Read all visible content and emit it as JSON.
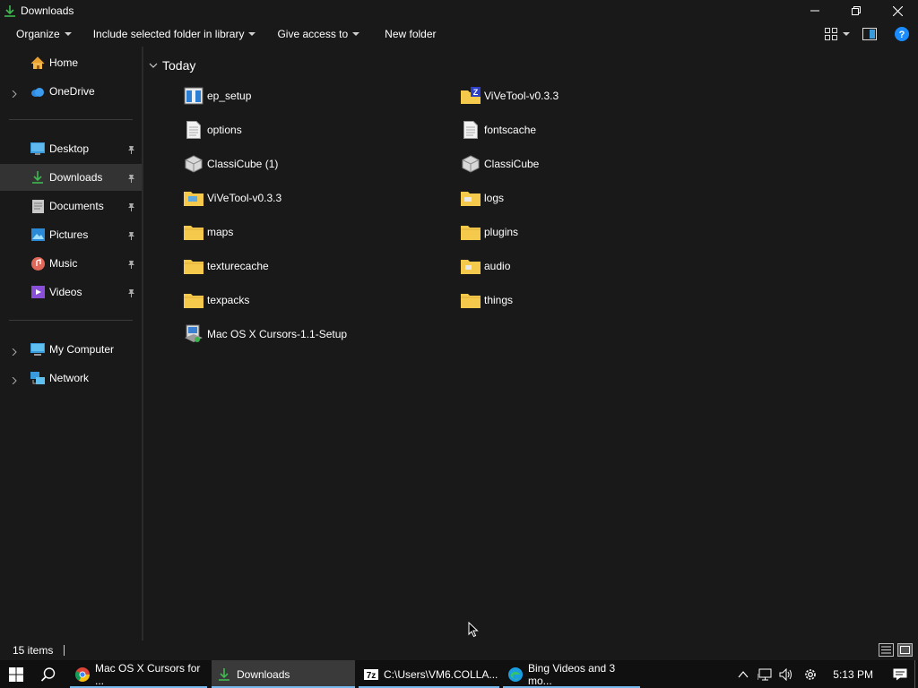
{
  "window": {
    "title": "Downloads",
    "controls": {
      "minimize": "—",
      "restore": "❐",
      "close": "✕"
    }
  },
  "command_bar": {
    "organize": "Organize",
    "include_in_library": "Include selected folder in library",
    "give_access": "Give access to",
    "new_folder": "New folder"
  },
  "sidebar": {
    "home": "Home",
    "onedrive": "OneDrive",
    "desktop": "Desktop",
    "downloads": "Downloads",
    "documents": "Documents",
    "pictures": "Pictures",
    "music": "Music",
    "videos": "Videos",
    "my_computer": "My Computer",
    "network": "Network"
  },
  "content": {
    "group": "Today",
    "files": [
      {
        "name": "ep_setup",
        "icon": "installer-icon"
      },
      {
        "name": "ViVeTool-v0.3.3",
        "icon": "zip-folder-icon"
      },
      {
        "name": "options",
        "icon": "text-file-icon"
      },
      {
        "name": "fontscache",
        "icon": "text-file-icon"
      },
      {
        "name": "ClassiCube (1)",
        "icon": "classicube-icon"
      },
      {
        "name": "ClassiCube",
        "icon": "classicube-icon"
      },
      {
        "name": "ViVeTool-v0.3.3",
        "icon": "folder-icon"
      },
      {
        "name": "logs",
        "icon": "folder-icon"
      },
      {
        "name": "maps",
        "icon": "folder-icon"
      },
      {
        "name": "plugins",
        "icon": "folder-icon"
      },
      {
        "name": "texturecache",
        "icon": "folder-icon"
      },
      {
        "name": "audio",
        "icon": "folder-icon"
      },
      {
        "name": "texpacks",
        "icon": "folder-icon"
      },
      {
        "name": "things",
        "icon": "folder-icon"
      },
      {
        "name": "Mac OS X Cursors-1.1-Setup",
        "icon": "setup-icon"
      }
    ]
  },
  "status_bar": {
    "item_count": "15 items"
  },
  "taskbar": {
    "apps": [
      {
        "label": "Mac OS X Cursors for ...",
        "icon": "chrome-icon"
      },
      {
        "label": "Downloads",
        "icon": "explorer-icon"
      },
      {
        "label": "C:\\Users\\VM6.COLLA...",
        "icon": "7zip-icon"
      },
      {
        "label": "Bing Videos and 3 mo...",
        "icon": "edge-icon"
      }
    ],
    "clock": "5:13 PM"
  },
  "colors": {
    "background": "#191919",
    "taskbar": "#101010",
    "selected": "#333333",
    "folder": "#f5c94c",
    "accent": "#76b9ed",
    "help": "#1a8cff"
  }
}
